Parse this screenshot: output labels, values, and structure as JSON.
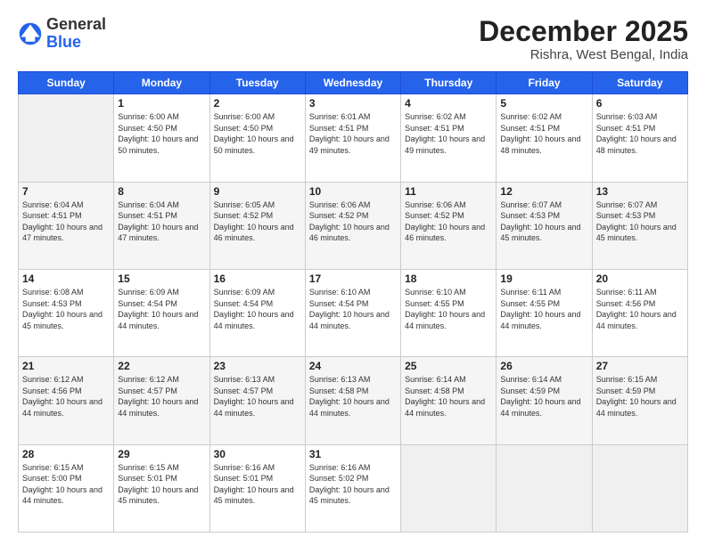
{
  "header": {
    "logo_general": "General",
    "logo_blue": "Blue",
    "month_title": "December 2025",
    "location": "Rishra, West Bengal, India"
  },
  "weekdays": [
    "Sunday",
    "Monday",
    "Tuesday",
    "Wednesday",
    "Thursday",
    "Friday",
    "Saturday"
  ],
  "weeks": [
    [
      {
        "day": "",
        "empty": true
      },
      {
        "day": "1",
        "sunrise": "Sunrise: 6:00 AM",
        "sunset": "Sunset: 4:50 PM",
        "daylight": "Daylight: 10 hours and 50 minutes."
      },
      {
        "day": "2",
        "sunrise": "Sunrise: 6:00 AM",
        "sunset": "Sunset: 4:50 PM",
        "daylight": "Daylight: 10 hours and 50 minutes."
      },
      {
        "day": "3",
        "sunrise": "Sunrise: 6:01 AM",
        "sunset": "Sunset: 4:51 PM",
        "daylight": "Daylight: 10 hours and 49 minutes."
      },
      {
        "day": "4",
        "sunrise": "Sunrise: 6:02 AM",
        "sunset": "Sunset: 4:51 PM",
        "daylight": "Daylight: 10 hours and 49 minutes."
      },
      {
        "day": "5",
        "sunrise": "Sunrise: 6:02 AM",
        "sunset": "Sunset: 4:51 PM",
        "daylight": "Daylight: 10 hours and 48 minutes."
      },
      {
        "day": "6",
        "sunrise": "Sunrise: 6:03 AM",
        "sunset": "Sunset: 4:51 PM",
        "daylight": "Daylight: 10 hours and 48 minutes."
      }
    ],
    [
      {
        "day": "7",
        "sunrise": "Sunrise: 6:04 AM",
        "sunset": "Sunset: 4:51 PM",
        "daylight": "Daylight: 10 hours and 47 minutes."
      },
      {
        "day": "8",
        "sunrise": "Sunrise: 6:04 AM",
        "sunset": "Sunset: 4:51 PM",
        "daylight": "Daylight: 10 hours and 47 minutes."
      },
      {
        "day": "9",
        "sunrise": "Sunrise: 6:05 AM",
        "sunset": "Sunset: 4:52 PM",
        "daylight": "Daylight: 10 hours and 46 minutes."
      },
      {
        "day": "10",
        "sunrise": "Sunrise: 6:06 AM",
        "sunset": "Sunset: 4:52 PM",
        "daylight": "Daylight: 10 hours and 46 minutes."
      },
      {
        "day": "11",
        "sunrise": "Sunrise: 6:06 AM",
        "sunset": "Sunset: 4:52 PM",
        "daylight": "Daylight: 10 hours and 46 minutes."
      },
      {
        "day": "12",
        "sunrise": "Sunrise: 6:07 AM",
        "sunset": "Sunset: 4:53 PM",
        "daylight": "Daylight: 10 hours and 45 minutes."
      },
      {
        "day": "13",
        "sunrise": "Sunrise: 6:07 AM",
        "sunset": "Sunset: 4:53 PM",
        "daylight": "Daylight: 10 hours and 45 minutes."
      }
    ],
    [
      {
        "day": "14",
        "sunrise": "Sunrise: 6:08 AM",
        "sunset": "Sunset: 4:53 PM",
        "daylight": "Daylight: 10 hours and 45 minutes."
      },
      {
        "day": "15",
        "sunrise": "Sunrise: 6:09 AM",
        "sunset": "Sunset: 4:54 PM",
        "daylight": "Daylight: 10 hours and 44 minutes."
      },
      {
        "day": "16",
        "sunrise": "Sunrise: 6:09 AM",
        "sunset": "Sunset: 4:54 PM",
        "daylight": "Daylight: 10 hours and 44 minutes."
      },
      {
        "day": "17",
        "sunrise": "Sunrise: 6:10 AM",
        "sunset": "Sunset: 4:54 PM",
        "daylight": "Daylight: 10 hours and 44 minutes."
      },
      {
        "day": "18",
        "sunrise": "Sunrise: 6:10 AM",
        "sunset": "Sunset: 4:55 PM",
        "daylight": "Daylight: 10 hours and 44 minutes."
      },
      {
        "day": "19",
        "sunrise": "Sunrise: 6:11 AM",
        "sunset": "Sunset: 4:55 PM",
        "daylight": "Daylight: 10 hours and 44 minutes."
      },
      {
        "day": "20",
        "sunrise": "Sunrise: 6:11 AM",
        "sunset": "Sunset: 4:56 PM",
        "daylight": "Daylight: 10 hours and 44 minutes."
      }
    ],
    [
      {
        "day": "21",
        "sunrise": "Sunrise: 6:12 AM",
        "sunset": "Sunset: 4:56 PM",
        "daylight": "Daylight: 10 hours and 44 minutes."
      },
      {
        "day": "22",
        "sunrise": "Sunrise: 6:12 AM",
        "sunset": "Sunset: 4:57 PM",
        "daylight": "Daylight: 10 hours and 44 minutes."
      },
      {
        "day": "23",
        "sunrise": "Sunrise: 6:13 AM",
        "sunset": "Sunset: 4:57 PM",
        "daylight": "Daylight: 10 hours and 44 minutes."
      },
      {
        "day": "24",
        "sunrise": "Sunrise: 6:13 AM",
        "sunset": "Sunset: 4:58 PM",
        "daylight": "Daylight: 10 hours and 44 minutes."
      },
      {
        "day": "25",
        "sunrise": "Sunrise: 6:14 AM",
        "sunset": "Sunset: 4:58 PM",
        "daylight": "Daylight: 10 hours and 44 minutes."
      },
      {
        "day": "26",
        "sunrise": "Sunrise: 6:14 AM",
        "sunset": "Sunset: 4:59 PM",
        "daylight": "Daylight: 10 hours and 44 minutes."
      },
      {
        "day": "27",
        "sunrise": "Sunrise: 6:15 AM",
        "sunset": "Sunset: 4:59 PM",
        "daylight": "Daylight: 10 hours and 44 minutes."
      }
    ],
    [
      {
        "day": "28",
        "sunrise": "Sunrise: 6:15 AM",
        "sunset": "Sunset: 5:00 PM",
        "daylight": "Daylight: 10 hours and 44 minutes."
      },
      {
        "day": "29",
        "sunrise": "Sunrise: 6:15 AM",
        "sunset": "Sunset: 5:01 PM",
        "daylight": "Daylight: 10 hours and 45 minutes."
      },
      {
        "day": "30",
        "sunrise": "Sunrise: 6:16 AM",
        "sunset": "Sunset: 5:01 PM",
        "daylight": "Daylight: 10 hours and 45 minutes."
      },
      {
        "day": "31",
        "sunrise": "Sunrise: 6:16 AM",
        "sunset": "Sunset: 5:02 PM",
        "daylight": "Daylight: 10 hours and 45 minutes."
      },
      {
        "day": "",
        "empty": true
      },
      {
        "day": "",
        "empty": true
      },
      {
        "day": "",
        "empty": true
      }
    ]
  ]
}
